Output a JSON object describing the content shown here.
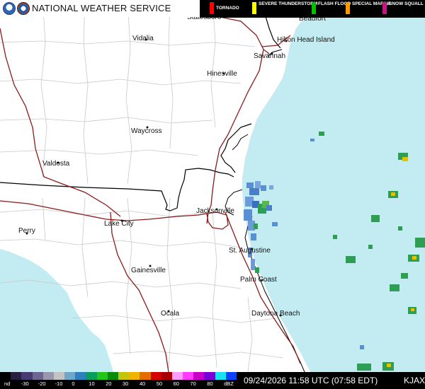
{
  "header": {
    "title": "NATIONAL WEATHER SERVICE",
    "legend": [
      {
        "label": "TORNADO",
        "color": "#ff0000"
      },
      {
        "label": "SEVERE THUNDERSTORM",
        "color": "#ffff00"
      },
      {
        "label": "FLASH FLOOD",
        "color": "#00c000"
      },
      {
        "label": "SPECIAL MARINE",
        "color": "#ff9900"
      },
      {
        "label": "SNOW SQUALL",
        "color": "#c71585"
      }
    ]
  },
  "cities": [
    {
      "name": "Statesboro"
    },
    {
      "name": "Beaufort"
    },
    {
      "name": "Vidalia"
    },
    {
      "name": "Hilton Head Island"
    },
    {
      "name": "Savannah"
    },
    {
      "name": "Hinesville"
    },
    {
      "name": "Waycross"
    },
    {
      "name": "Valdosta"
    },
    {
      "name": "Jacksonville"
    },
    {
      "name": "Perry"
    },
    {
      "name": "Lake City"
    },
    {
      "name": "St. Augustine"
    },
    {
      "name": "Gainesville"
    },
    {
      "name": "Palm Coast"
    },
    {
      "name": "Ocala"
    },
    {
      "name": "Daytona Beach"
    }
  ],
  "footer": {
    "scale_labels": [
      "nd",
      "-30",
      "-20",
      "-10",
      "0",
      "10",
      "20",
      "30",
      "40",
      "50",
      "60",
      "70",
      "80",
      "dBZ"
    ],
    "scale_colors": [
      "#000000",
      "#2a1f40",
      "#463a6e",
      "#6e6490",
      "#9a96ac",
      "#c3c3c3",
      "#6fa7c9",
      "#2f7fbe",
      "#0a9e5d",
      "#25c41a",
      "#0c8a0c",
      "#c5c40c",
      "#f0b400",
      "#e36d00",
      "#d40000",
      "#a60000",
      "#ff9cff",
      "#ff3cff",
      "#c800c8",
      "#7a00d8",
      "#18e2f2",
      "#0a42ff"
    ],
    "timestamp": "09/24/2026 11:58 UTC (07:58 EDT)",
    "radar_id": "KJAX"
  },
  "colors": {
    "ocean": "#c2ecf2",
    "land": "#ffffff",
    "highway": "#8b1a1a",
    "state_line": "#000000",
    "county": "#c9c9c9"
  }
}
